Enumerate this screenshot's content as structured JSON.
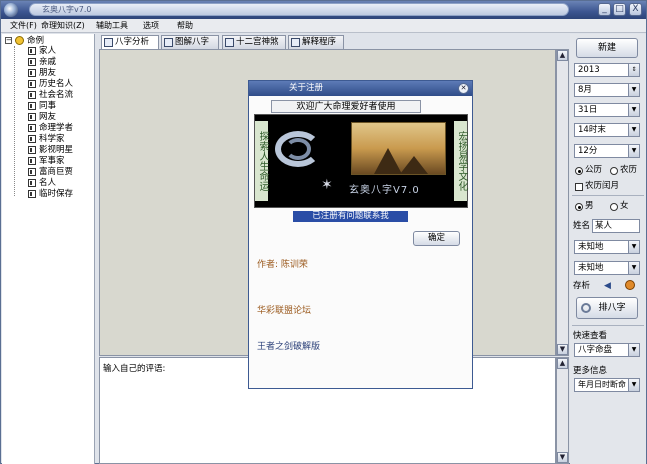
{
  "window": {
    "title": "玄奥八字v7.0",
    "controls": [
      "_",
      "□",
      "X"
    ]
  },
  "menu": [
    {
      "label": "文件(F)",
      "id": "file"
    },
    {
      "label": "命理知识(Z)",
      "id": "knowledge"
    },
    {
      "label": "辅助工具",
      "id": "tools"
    },
    {
      "label": "选项",
      "id": "options"
    },
    {
      "label": "帮助",
      "id": "help"
    }
  ],
  "tree": {
    "root": "命例",
    "items": [
      "家人",
      "亲戚",
      "朋友",
      "历史名人",
      "社会名流",
      "同事",
      "网友",
      "命理学者",
      "科学家",
      "影视明星",
      "军事家",
      "富商巨贾",
      "名人",
      "临时保存"
    ]
  },
  "tabs": [
    {
      "label": "八字分析",
      "active": true
    },
    {
      "label": "图解八字",
      "active": false
    },
    {
      "label": "十二宫神煞",
      "active": false
    },
    {
      "label": "解释程序",
      "active": false
    }
  ],
  "comment": {
    "label": "输入自己的评语:"
  },
  "right_panel": {
    "new_button": "新建",
    "year": "2013",
    "month": "8月",
    "day": "31日",
    "hour": "14时末",
    "minute": "12分",
    "calendar_solar": "公历",
    "calendar_lunar": "农历",
    "leap_month": "农历闰月",
    "gender_male": "男",
    "gender_female": "女",
    "name_label": "姓名",
    "name_value": "某人",
    "place1": "未知地",
    "place2": "未知地",
    "save_label": "存析",
    "arrange_button": "排八字",
    "quick_view_label": "快速查看",
    "quick_view_value": "八字命盘",
    "more_info_label": "更多信息",
    "more_info_value": "年月日时断命"
  },
  "dialog": {
    "title": "关于注册",
    "welcome": "欢迎广大命理爱好者使用",
    "side_left": "探索人生命运",
    "side_right": "宏扬易学文化",
    "brand": "玄奥八字V7.0",
    "status": "已注册有问题联系我",
    "ok_button": "确定",
    "author": "作者: 陈训荣",
    "forum": "华彩联盟论坛",
    "cracker": "王者之剑破解版"
  }
}
